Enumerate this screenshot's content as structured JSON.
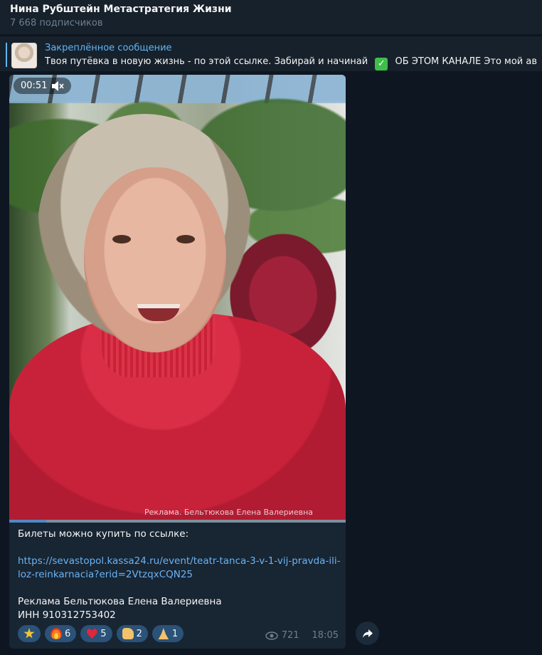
{
  "header": {
    "title": "Нина Рубштейн Метастратегия Жизни",
    "subtitle": "7 668 подписчиков"
  },
  "pinned": {
    "label": "Закреплённое сообщение",
    "text_before": "Твоя путёвка в новую жизнь - по этой ссылке. Забирай и начинай",
    "text_after": "ОБ ЭТОМ КАНАЛЕ  Это мой ав"
  },
  "video": {
    "duration": "00:51",
    "watermark": "Реклама. Бельтюкова Елена Валериевна",
    "progress": 0.11
  },
  "caption": {
    "line1": "Билеты можно купить по ссылке:",
    "link": "https://sevastopol.kassa24.ru/event/teatr-tanca-3-v-1-vij-pravda-ili-loz-reinkarnacia?erid=2VtzqxCQN25",
    "ad_line": "Реклама Бельтюкова Елена Валериевна",
    "inn": "ИНН 910312753402"
  },
  "reactions": [
    {
      "icon": "star-icon",
      "count": ""
    },
    {
      "icon": "fire-icon",
      "count": "6"
    },
    {
      "icon": "heart-icon",
      "count": "5"
    },
    {
      "icon": "thumbs-up-icon",
      "count": "2"
    },
    {
      "icon": "pray-icon",
      "count": "1"
    }
  ],
  "meta": {
    "views": "721",
    "time": "18:05"
  },
  "colors": {
    "background": "#0e1621",
    "bubble": "#182533",
    "accent": "#5eb5f7",
    "link": "#6ab3f3",
    "reaction_bg": "#2b5278"
  }
}
